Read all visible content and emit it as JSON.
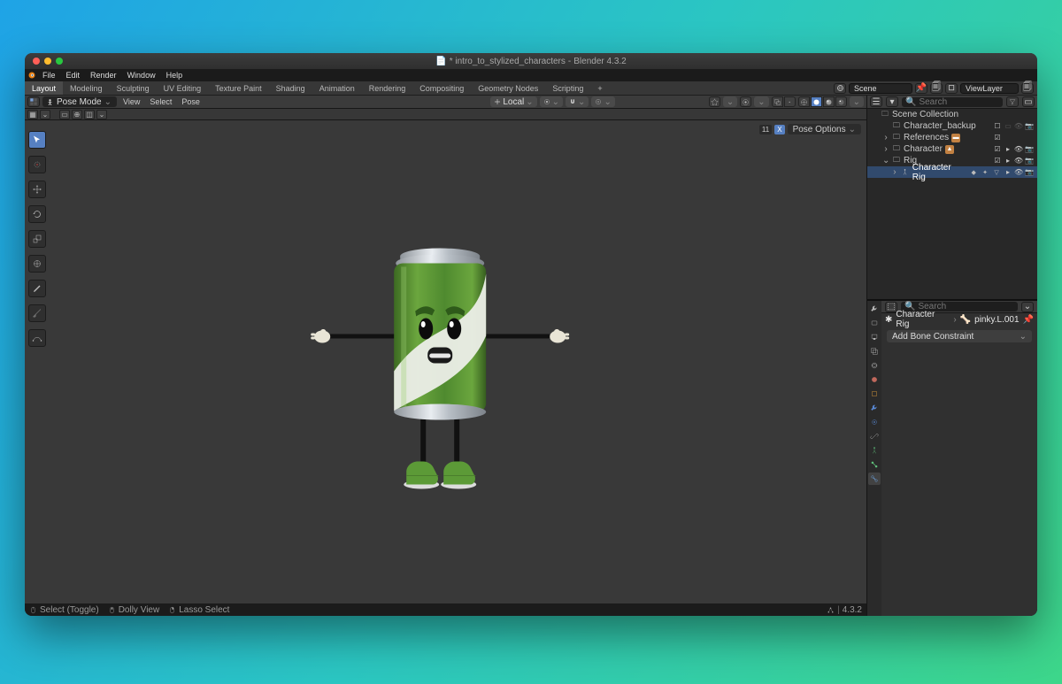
{
  "title": {
    "doc_icon": "📄",
    "filename": "* intro_to_stylized_characters",
    "app": "Blender 4.3.2"
  },
  "menus": [
    "File",
    "Edit",
    "Render",
    "Window",
    "Help"
  ],
  "workspaces": [
    "Layout",
    "Modeling",
    "Sculpting",
    "UV Editing",
    "Texture Paint",
    "Shading",
    "Animation",
    "Rendering",
    "Compositing",
    "Geometry Nodes",
    "Scripting"
  ],
  "workspace_active": "Layout",
  "top_right": {
    "scene_label": "Scene",
    "viewlayer_label": "ViewLayer"
  },
  "viewport": {
    "mode": "Pose Mode",
    "menus": [
      "View",
      "Select",
      "Pose"
    ],
    "orientation": "Local",
    "pose_options": "Pose Options",
    "pose_badge": "11",
    "pose_x": "X"
  },
  "outliner": {
    "search_placeholder": "Search",
    "rows": [
      {
        "depth": 0,
        "tw": "",
        "icon": "scene",
        "label": "Scene Collection",
        "ricons": []
      },
      {
        "depth": 1,
        "tw": "",
        "icon": "coll",
        "label": "Character_backup",
        "ricons": [
          "mute",
          "cb",
          "hide",
          "rend"
        ]
      },
      {
        "depth": 1,
        "tw": "›",
        "icon": "coll",
        "label": "References",
        "chip": "or",
        "ricons": [
          "cb",
          "",
          "",
          ""
        ]
      },
      {
        "depth": 1,
        "tw": "›",
        "icon": "coll",
        "label": "Character",
        "chip": "or",
        "ricons": [
          "cb",
          "sel",
          "eye",
          "rend"
        ]
      },
      {
        "depth": 1,
        "tw": "⌄",
        "icon": "coll",
        "label": "Rig",
        "ricons": [
          "cb",
          "sel",
          "eye",
          "rend"
        ]
      },
      {
        "depth": 2,
        "tw": "›",
        "icon": "arm",
        "label": "Character Rig",
        "sel": true,
        "extra": true,
        "ricons": [
          "sel",
          "eye",
          "rend"
        ]
      }
    ]
  },
  "props": {
    "search_placeholder": "Search",
    "crumb_obj": "Character Rig",
    "crumb_bone": "pinky.L.001",
    "add_bone": "Add Bone Constraint"
  },
  "status": {
    "items": [
      "Select (Toggle)",
      "Dolly View",
      "Lasso Select"
    ],
    "version": "4.3.2"
  }
}
